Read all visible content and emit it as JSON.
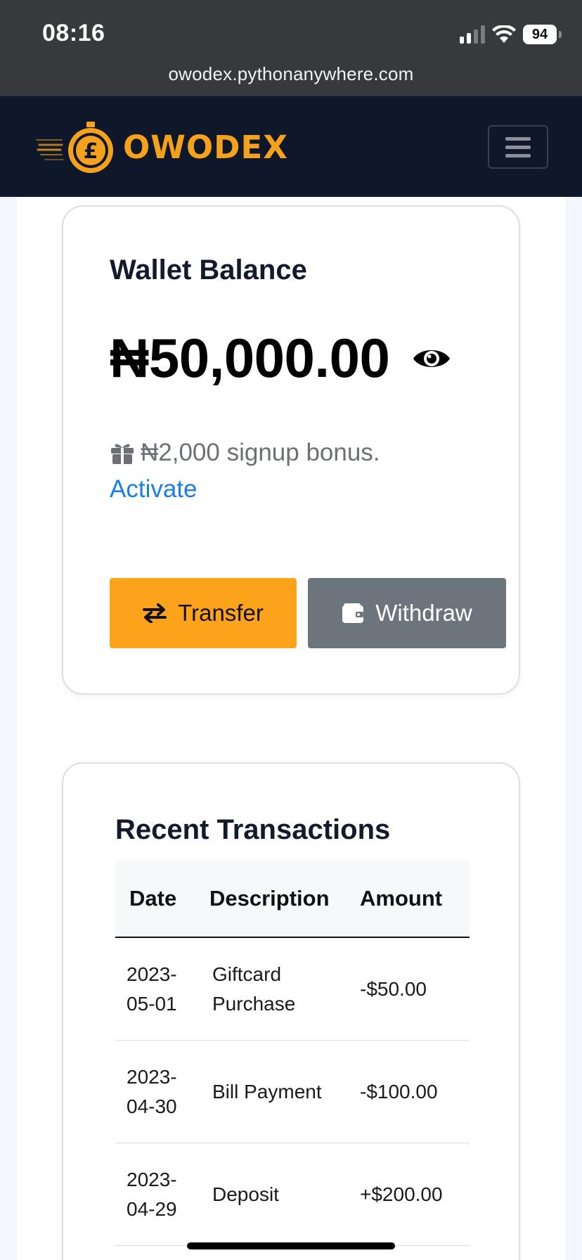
{
  "status_bar": {
    "time": "08:16",
    "battery": "94"
  },
  "browser": {
    "url": "owodex.pythonanywhere.com"
  },
  "navbar": {
    "brand": "OWODEX"
  },
  "wallet": {
    "title": "Wallet Balance",
    "balance": "₦50,000.00",
    "bonus_text": "₦2,000 signup bonus.",
    "activate_label": "Activate",
    "transfer_label": "Transfer",
    "withdraw_label": "Withdraw"
  },
  "transactions": {
    "title": "Recent Transactions",
    "headers": {
      "date": "Date",
      "description": "Description",
      "amount": "Amount"
    },
    "rows": [
      {
        "date_year": "2023-",
        "date_md": "05-01",
        "desc_line1": "Giftcard",
        "desc_line2": "Purchase",
        "amount": "-$50.00"
      },
      {
        "date_year": "2023-",
        "date_md": "04-30",
        "desc_line1": "Bill Payment",
        "desc_line2": "",
        "amount": "-$100.00"
      },
      {
        "date_year": "2023-",
        "date_md": "04-29",
        "desc_line1": "Deposit",
        "desc_line2": "",
        "amount": "+$200.00"
      }
    ]
  },
  "colors": {
    "navbar_bg": "#0f182b",
    "brand_orange": "#f6a11b",
    "transfer_button": "#fca21b",
    "withdraw_button": "#6c757d",
    "link_blue": "#1a7ee6"
  },
  "icons": [
    "signal-icon",
    "wifi-icon",
    "battery-icon",
    "logo-stopwatch-icon",
    "hamburger-icon",
    "eye-icon",
    "gift-icon",
    "transfer-arrows-icon",
    "wallet-icon"
  ]
}
